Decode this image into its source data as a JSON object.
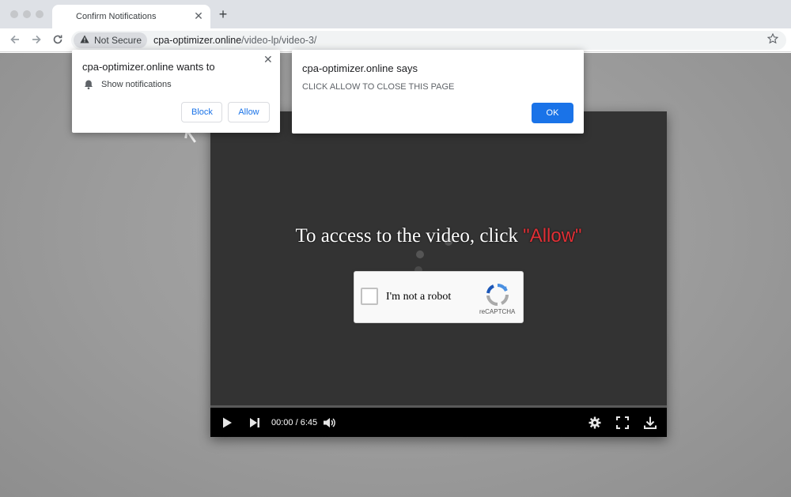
{
  "tab": {
    "title": "Confirm Notifications",
    "close_glyph": "✕",
    "new_tab_glyph": "+"
  },
  "toolbar": {
    "back_icon": "back-arrow-icon",
    "forward_icon": "forward-arrow-icon",
    "reload_icon": "reload-icon",
    "security_label": "Not Secure",
    "url_host": "cpa-optimizer.online",
    "url_path": "/video-lp/video-3/",
    "bookmark_icon": "star-icon"
  },
  "permission_prompt": {
    "title": "cpa-optimizer.online wants to",
    "item": "Show notifications",
    "block_label": "Block",
    "allow_label": "Allow",
    "close_glyph": "✕"
  },
  "alert_dialog": {
    "title": "cpa-optimizer.online says",
    "message": "CLICK ALLOW TO CLOSE THIS PAGE",
    "ok_label": "OK"
  },
  "player": {
    "headline_prefix": "To access to the video, click ",
    "headline_allow": "\"Allow\"",
    "captcha_label": "I'm not a robot",
    "captcha_brand": "reCAPTCHA",
    "time": "00:00 / 6:45",
    "progress": 0.0
  },
  "colors": {
    "accent_blue": "#1a73e8",
    "allow_red": "#e03036",
    "player_bg": "#333333"
  }
}
